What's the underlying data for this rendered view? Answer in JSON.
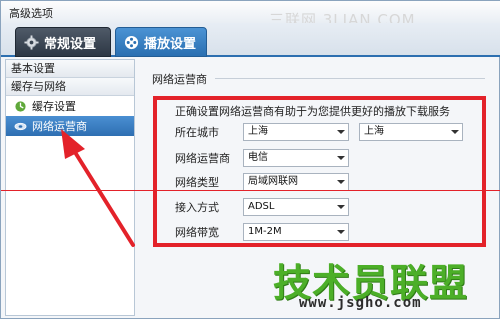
{
  "window": {
    "title": "高级选项"
  },
  "watermark": {
    "top": "三联网 3LIAN.COM"
  },
  "tabs": [
    {
      "label": "常规设置",
      "icon": "gear-icon"
    },
    {
      "label": "播放设置",
      "icon": "film-icon"
    }
  ],
  "sidebar": {
    "sections": [
      {
        "label": "基本设置"
      },
      {
        "label": "缓存与网络"
      }
    ],
    "items": [
      {
        "label": "缓存设置",
        "icon": "cache-icon",
        "selected": false
      },
      {
        "label": "网络运营商",
        "icon": "network-icon",
        "selected": true
      }
    ]
  },
  "main": {
    "group_title": "网络运营商",
    "hint": "正确设置网络运营商有助于为您提供更好的播放下载服务",
    "fields": [
      {
        "label": "所在城市",
        "value": "上海",
        "value2": "上海"
      },
      {
        "label": "网络运营商",
        "value": "电信"
      },
      {
        "label": "网络类型",
        "value": "局域网联网"
      },
      {
        "label": "接入方式",
        "value": "ADSL"
      },
      {
        "label": "网络带宽",
        "value": "1M-2M"
      }
    ]
  },
  "brand": {
    "name": "技术员联盟",
    "url": "www.jsgho.com"
  },
  "colors": {
    "accent": "#2e6fb2",
    "highlight": "#e3222a",
    "brand": "#4caf28"
  }
}
